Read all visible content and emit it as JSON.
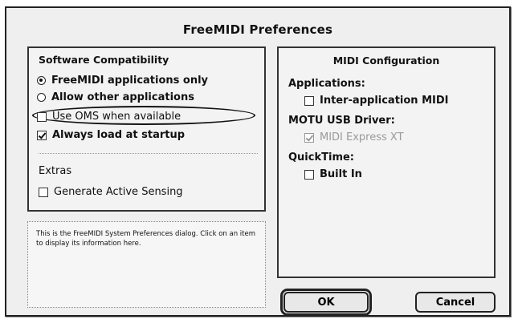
{
  "dialog": {
    "title": "FreeMIDI Preferences"
  },
  "software_compat": {
    "title": "Software Compatibility",
    "radio_freemidi_only": "FreeMIDI applications only",
    "radio_allow_other": "Allow other applications",
    "oms_label": "Use OMS when available",
    "always_load_label": "Always load at startup",
    "extras_label": "Extras",
    "active_sensing_label": "Generate Active Sensing"
  },
  "midi_config": {
    "title": "MIDI Configuration",
    "applications_label": "Applications:",
    "inter_app_label": "Inter-application MIDI",
    "usb_driver_label": "MOTU USB Driver:",
    "midi_express_label": "MIDI Express XT",
    "quicktime_label": "QuickTime:",
    "built_in_label": "Built In"
  },
  "info_text": "This is the FreeMIDI System Preferences dialog.  Click on an item to display its information here.",
  "buttons": {
    "ok": "OK",
    "cancel": "Cancel"
  }
}
